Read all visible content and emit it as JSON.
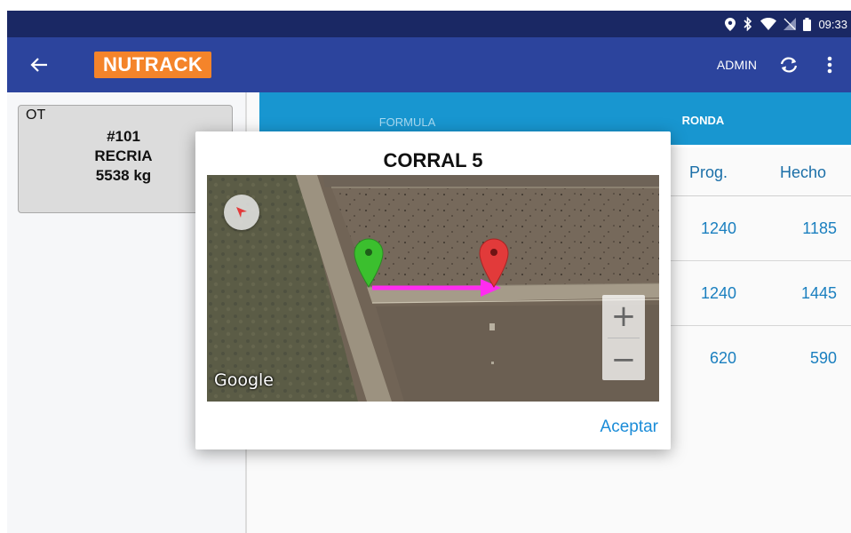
{
  "status_bar": {
    "time": "09:33",
    "icons": [
      "location-icon",
      "bluetooth-icon",
      "wifi-icon",
      "no-sim-icon",
      "battery-icon"
    ]
  },
  "app_bar": {
    "logo_text": "NUTRACK",
    "user": "ADMIN"
  },
  "ot_card": {
    "label": "OT",
    "number": "#101",
    "type": "RECRIA",
    "weight": "5538 kg"
  },
  "tabs": [
    {
      "label": "FORMULA",
      "active": false
    },
    {
      "label": "RONDA",
      "active": true
    }
  ],
  "table": {
    "headers": [
      "Prog.",
      "Hecho"
    ],
    "rows": [
      [
        "1240",
        "1185"
      ],
      [
        "1240",
        "1445"
      ],
      [
        "620",
        "590"
      ]
    ]
  },
  "dialog": {
    "title": "CORRAL 5",
    "map_attribution": "Google",
    "accept_label": "Aceptar",
    "zoom_in_label": "+",
    "zoom_out_label": "−"
  },
  "colors": {
    "status_bar": "#1a2864",
    "app_bar": "#2c449d",
    "logo": "#f4842a",
    "tabs": "#1896d0",
    "accent": "#1a8cd8",
    "marker_start": "#3bbf2e",
    "marker_end": "#e23a3a",
    "route_arrow": "#ff2cf0"
  }
}
